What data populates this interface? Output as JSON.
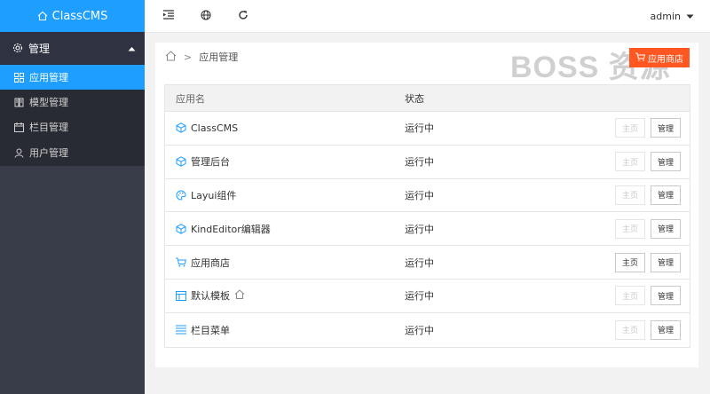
{
  "app": {
    "title": "ClassCMS"
  },
  "sidebar": {
    "group_label": "管理",
    "items": [
      {
        "label": "应用管理",
        "icon": "apps-icon",
        "active": true
      },
      {
        "label": "模型管理",
        "icon": "model-icon",
        "active": false
      },
      {
        "label": "栏目管理",
        "icon": "calendar-icon",
        "active": false
      },
      {
        "label": "用户管理",
        "icon": "user-icon",
        "active": false
      }
    ]
  },
  "header": {
    "user": "admin"
  },
  "breadcrumb": {
    "current": "应用管理"
  },
  "store_button": {
    "label": "应用商店"
  },
  "watermark": "BOSS 资源",
  "table": {
    "columns": [
      "应用名",
      "状态"
    ],
    "home_label": "主页",
    "manage_label": "管理",
    "rows": [
      {
        "name": "ClassCMS",
        "icon": "cube-icon",
        "status": "运行中",
        "home_enabled": false
      },
      {
        "name": "管理后台",
        "icon": "cube-icon",
        "status": "运行中",
        "home_enabled": false
      },
      {
        "name": "Layui组件",
        "icon": "palette-icon",
        "status": "运行中",
        "home_enabled": false
      },
      {
        "name": "KindEditor编辑器",
        "icon": "cube-icon",
        "status": "运行中",
        "home_enabled": false
      },
      {
        "name": "应用商店",
        "icon": "cart-icon",
        "status": "运行中",
        "home_enabled": true
      },
      {
        "name": "默认模板",
        "icon": "template-icon",
        "status": "运行中",
        "home_enabled": false,
        "home_marker": true
      },
      {
        "name": "栏目菜单",
        "icon": "list-icon",
        "status": "运行中",
        "home_enabled": false
      }
    ]
  },
  "colors": {
    "brand": "#1e9fff",
    "sidebar": "#393d49",
    "store": "#ff5722",
    "accent_icon": "#1e9fff"
  }
}
